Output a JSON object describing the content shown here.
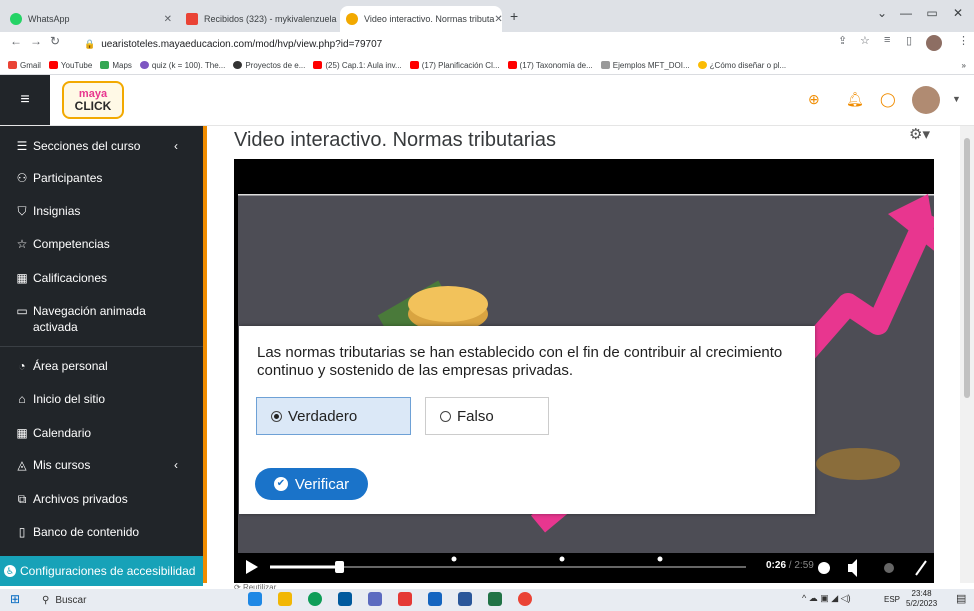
{
  "browser": {
    "tabs": [
      {
        "title": "WhatsApp",
        "color": "#25d366",
        "active": false
      },
      {
        "title": "Recibidos (323) - mykivalenzuela",
        "color": "#ea4335",
        "active": false
      },
      {
        "title": "Video interactivo. Normas tributa",
        "color": "#f2a900",
        "active": true
      }
    ],
    "new_tab": "+",
    "url": "uearistoteles.mayaeducacion.com/mod/hvp/view.php?id=79707",
    "bookmarks": [
      {
        "label": "Gmail",
        "color": "#ea4335"
      },
      {
        "label": "YouTube",
        "color": "#ff0000"
      },
      {
        "label": "Maps",
        "color": "#34a853"
      },
      {
        "label": "quiz (k = 100). The...",
        "color": "#7e57c2"
      },
      {
        "label": "Proyectos de e...",
        "color": "#333333"
      },
      {
        "label": "(25) Cap.1: Aula inv...",
        "color": "#ff0000"
      },
      {
        "label": "(17) Planificación Cl...",
        "color": "#ff0000"
      },
      {
        "label": "(17) Taxonomía de...",
        "color": "#ff0000"
      },
      {
        "label": "Ejemplos MFT_DOI...",
        "color": "#999999"
      },
      {
        "label": "¿Cómo diseñar o pl...",
        "color": "#fbbc04"
      }
    ]
  },
  "header": {
    "logo_top": "maya",
    "logo_bottom": "CLICK"
  },
  "sidebar": {
    "items": [
      {
        "label": "Secciones del curso",
        "icon": "list-icon"
      },
      {
        "label": "Participantes",
        "icon": "users-icon"
      },
      {
        "label": "Insignias",
        "icon": "badge-icon"
      },
      {
        "label": "Competencias",
        "icon": "star-icon"
      },
      {
        "label": "Calificaciones",
        "icon": "grades-icon"
      },
      {
        "label": "Navegación animada activada",
        "icon": "folder-icon"
      },
      {
        "label": "Área personal",
        "icon": "dashboard-icon"
      },
      {
        "label": "Inicio del sitio",
        "icon": "home-icon"
      },
      {
        "label": "Calendario",
        "icon": "calendar-icon"
      },
      {
        "label": "Mis cursos",
        "icon": "graduation-icon"
      },
      {
        "label": "Archivos privados",
        "icon": "files-icon"
      },
      {
        "label": "Banco de contenido",
        "icon": "clipboard-icon"
      }
    ],
    "accessibility": "Configuraciones de accesibilidad"
  },
  "main": {
    "title": "Video interactivo. Normas tributarias",
    "question": "Las normas tributarias se han establecido con el fin de contribuir al crecimiento continuo y sostenido de las empresas privadas.",
    "option_true": "Verdadero",
    "option_false": "Falso",
    "selected": "Verdadero",
    "verify": "Verificar",
    "time_current": "0:26",
    "time_total": "/ 2:59",
    "progress": 0.145,
    "reuse": "Reutilizar"
  },
  "taskbar": {
    "search": "Buscar",
    "lang": "ESP",
    "time": "23:48",
    "date": "5/2/2023"
  },
  "colors": {
    "accent_orange": "#f08c00",
    "sidebar_bg": "#212529",
    "accessibility_bg": "#17a2b8",
    "verify_blue": "#1a73c9",
    "arrow_pink": "#e8368f"
  }
}
